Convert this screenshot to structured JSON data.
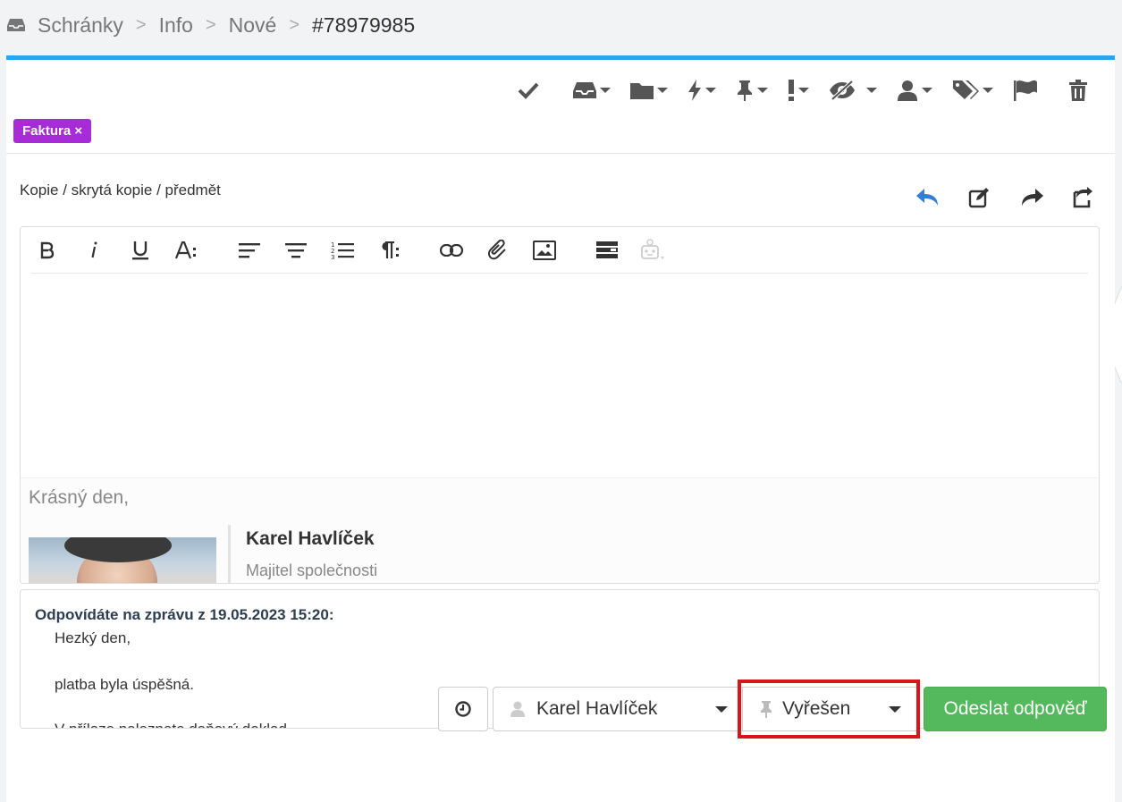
{
  "breadcrumb": {
    "items": [
      "Schránky",
      "Info",
      "Nové",
      "#78979985"
    ]
  },
  "tag": {
    "label": "Faktura ×",
    "color": "#a72bd7"
  },
  "recipients_link": "Kopie / skrytá kopie / předmět",
  "editor": {
    "greeting": "Krásný den,",
    "signature_name": "Karel Havlíček",
    "signature_role": "Majitel společnosti"
  },
  "quote": {
    "header": "Odpovídáte na zprávu z 19.05.2023 15:20:",
    "lines": [
      "Hezký den,",
      "platba byla úspěšná.",
      "V příloze naleznete daňový doklad."
    ]
  },
  "footer": {
    "assignee": "Karel Havlíček",
    "status": "Vyřešen",
    "send_label": "Odeslat odpověď"
  },
  "colors": {
    "accent": "#2fa4e7",
    "send": "#54b95c",
    "highlight": "#d9141b"
  }
}
